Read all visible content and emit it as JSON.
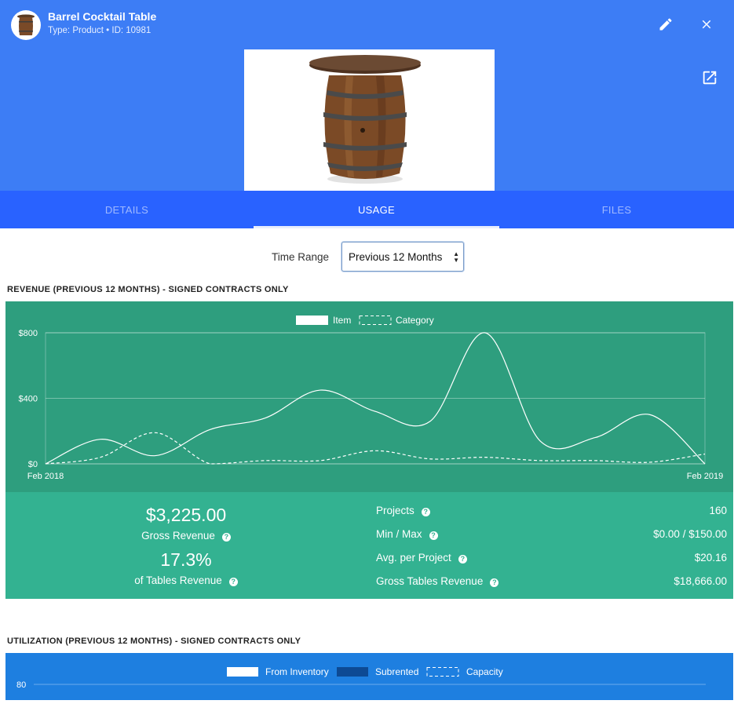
{
  "header": {
    "title": "Barrel Cocktail Table",
    "subtitle": "Type: Product • ID: 10981",
    "edit_icon": "pencil-icon",
    "close_icon": "close-icon",
    "open_external_icon": "open-in-new-icon"
  },
  "tabs": [
    {
      "label": "DETAILS",
      "active": false
    },
    {
      "label": "USAGE",
      "active": true
    },
    {
      "label": "FILES",
      "active": false
    }
  ],
  "time_range": {
    "label": "Time Range",
    "selected": "Previous 12 Months"
  },
  "revenue": {
    "section_title": "REVENUE (PREVIOUS 12 MONTHS) - SIGNED CONTRACTS ONLY",
    "gross_revenue": "$3,225.00",
    "gross_revenue_label": "Gross Revenue",
    "percent": "17.3%",
    "percent_label": "of Tables Revenue",
    "stats": [
      {
        "label": "Projects",
        "value": "160"
      },
      {
        "label": "Min / Max",
        "value": "$0.00 / $150.00"
      },
      {
        "label": "Avg. per Project",
        "value": "$20.16"
      },
      {
        "label": "Gross Tables Revenue",
        "value": "$18,666.00"
      }
    ]
  },
  "utilization": {
    "section_title": "UTILIZATION (PREVIOUS 12 MONTHS) - SIGNED CONTRACTS ONLY",
    "legend": [
      "From Inventory",
      "Subrented",
      "Capacity"
    ],
    "y_top_tick": "80"
  },
  "colors": {
    "header_bg": "#3d7df5",
    "tabs_bg": "#2962ff",
    "revenue_chart_bg": "#2e9e7e",
    "revenue_stats_bg": "#33b291",
    "utilization_bg": "#1e7fe0"
  },
  "chart_data": [
    {
      "type": "line",
      "title": "REVENUE (PREVIOUS 12 MONTHS) - SIGNED CONTRACTS ONLY",
      "x_tick_labels": [
        "Feb 2018",
        "Feb 2019"
      ],
      "y_ticks": [
        "$0",
        "$400",
        "$800"
      ],
      "ylim": [
        0,
        800
      ],
      "grid": true,
      "legend_position": "top-center",
      "series": [
        {
          "name": "Item",
          "style": "solid",
          "values": [
            0,
            150,
            50,
            210,
            280,
            450,
            320,
            260,
            800,
            140,
            160,
            300,
            0
          ]
        },
        {
          "name": "Category",
          "style": "dashed",
          "values": [
            0,
            40,
            190,
            0,
            20,
            20,
            80,
            30,
            40,
            20,
            20,
            10,
            60
          ]
        }
      ]
    }
  ]
}
